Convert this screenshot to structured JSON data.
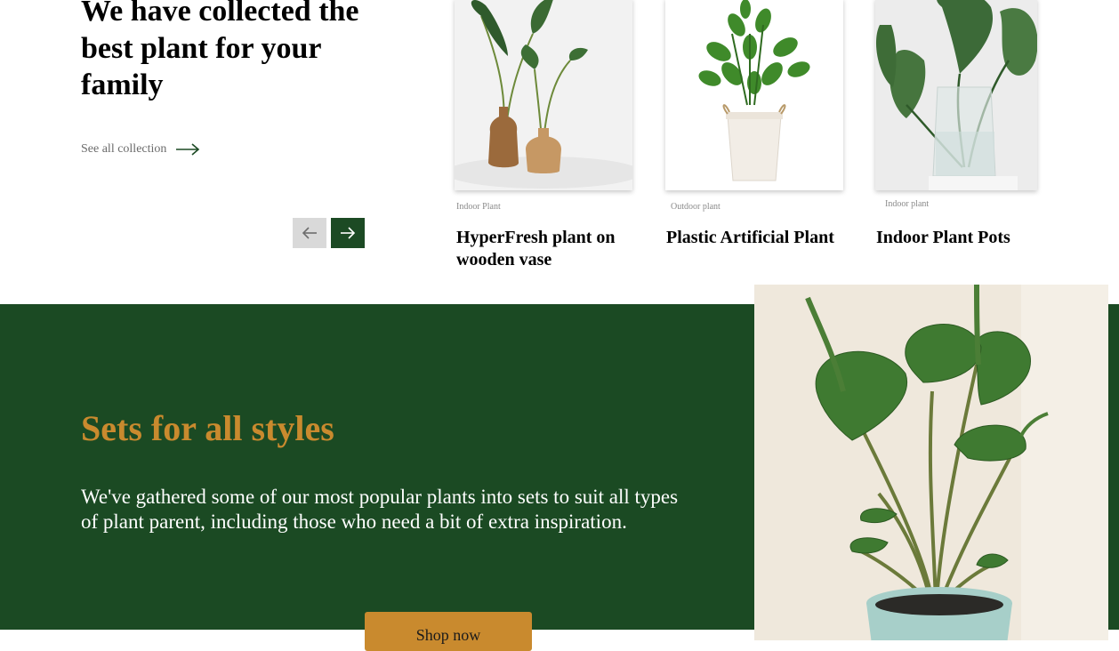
{
  "hero": {
    "headline": "We have collected the best plant for your family",
    "see_all_label": "See all collection"
  },
  "carousel": {
    "prev_icon": "arrow-left-icon",
    "next_icon": "arrow-right-icon",
    "cards": [
      {
        "category": "Indoor Plant",
        "title": "HyperFresh plant on wooden vase"
      },
      {
        "category": "Outdoor plant",
        "title": "Plastic Artificial Plant"
      },
      {
        "category": "Indoor plant",
        "title": "Indoor Plant Pots"
      }
    ]
  },
  "sets": {
    "title": "Sets for all styles",
    "body": "We've gathered some of our most popular plants into sets to suit all types of plant parent, including those who need a bit of extra inspiration.",
    "cta_label": "Shop now"
  },
  "colors": {
    "brand_green": "#1b4a23",
    "accent_gold": "#c98a2e",
    "nav_prev_bg": "#d9d9d9"
  }
}
